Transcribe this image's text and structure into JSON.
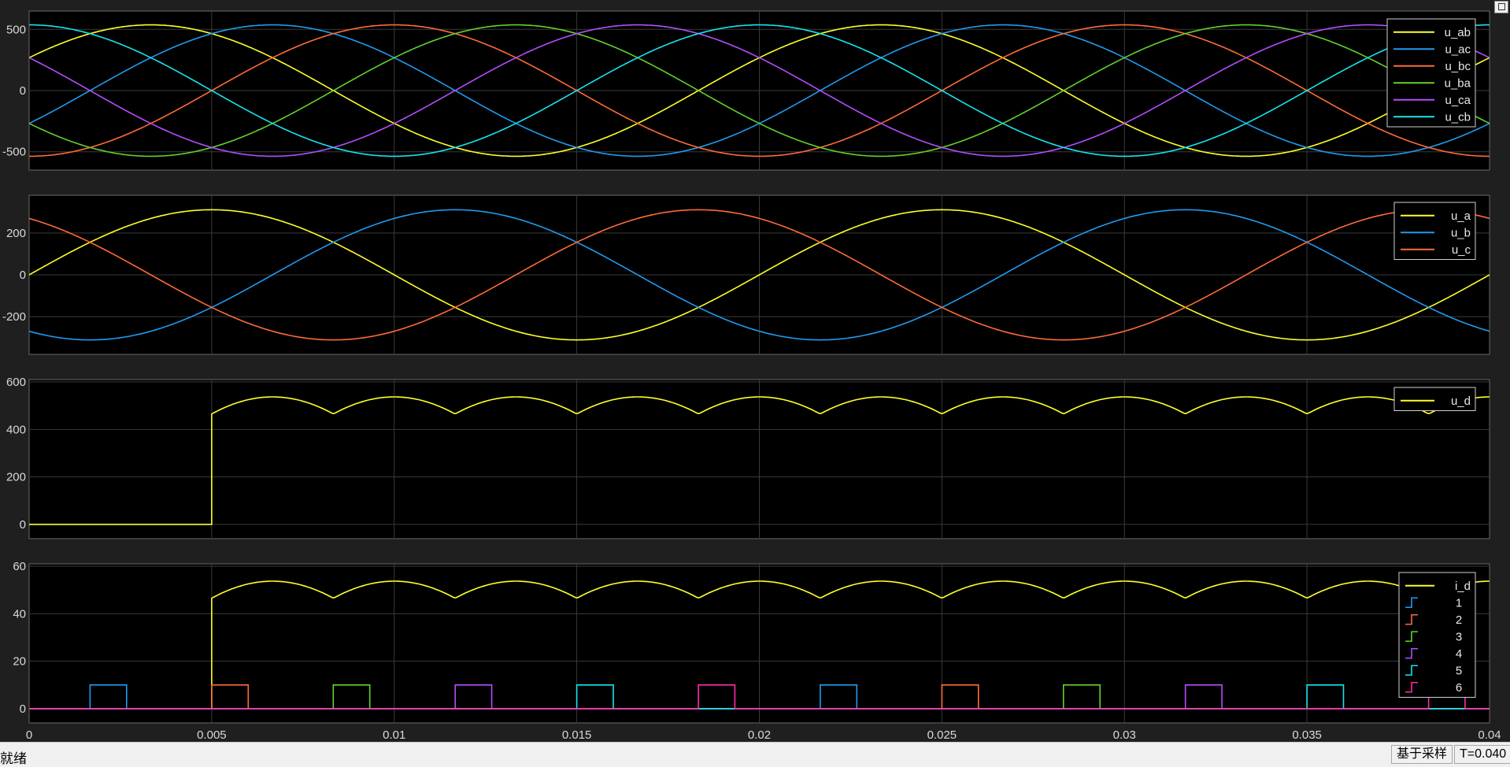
{
  "status": {
    "ready": "就绪",
    "mode": "基于采样",
    "time": "T=0.040"
  },
  "colors": {
    "background": "#000000",
    "grid": "#3a3a3a",
    "axis_text": "#d9d9d9",
    "yellow": "#ffff2a",
    "blue": "#1f9bf0",
    "orange": "#ff6b36",
    "green": "#62d22d",
    "purple": "#b44dff",
    "cyan": "#16e5f0",
    "magenta": "#ff2aa8"
  },
  "chart_data": [
    {
      "type": "line",
      "title": "",
      "xlim": [
        0,
        0.04
      ],
      "ylim": [
        -650,
        650
      ],
      "yticks": [
        -500,
        0,
        500
      ],
      "grid": true,
      "legend": "top-right",
      "series": [
        {
          "name": "u_ab",
          "color": "yellow",
          "amplitude": 537,
          "phase_deg": 30
        },
        {
          "name": "u_ac",
          "color": "blue",
          "amplitude": 537,
          "phase_deg": -30
        },
        {
          "name": "u_bc",
          "color": "orange",
          "amplitude": 537,
          "phase_deg": -90
        },
        {
          "name": "u_ba",
          "color": "green",
          "amplitude": 537,
          "phase_deg": -150
        },
        {
          "name": "u_ca",
          "color": "purple",
          "amplitude": 537,
          "phase_deg": 150
        },
        {
          "name": "u_cb",
          "color": "cyan",
          "amplitude": 537,
          "phase_deg": 90
        }
      ],
      "frequency_hz": 50
    },
    {
      "type": "line",
      "title": "",
      "xlim": [
        0,
        0.04
      ],
      "ylim": [
        -380,
        380
      ],
      "yticks": [
        -200,
        0,
        200
      ],
      "grid": true,
      "legend": "top-right",
      "series": [
        {
          "name": "u_a",
          "color": "yellow",
          "amplitude": 311,
          "phase_deg": 0
        },
        {
          "name": "u_b",
          "color": "blue",
          "amplitude": 311,
          "phase_deg": -120
        },
        {
          "name": "u_c",
          "color": "orange",
          "amplitude": 311,
          "phase_deg": 120
        }
      ],
      "frequency_hz": 50
    },
    {
      "type": "line",
      "title": "",
      "xlim": [
        0,
        0.04
      ],
      "ylim": [
        -60,
        610
      ],
      "yticks": [
        0,
        200,
        400,
        600
      ],
      "grid": true,
      "legend": "top-right",
      "series": [
        {
          "name": "u_d",
          "color": "yellow",
          "start_time": 0.005,
          "peak": 537,
          "pre_value": 0
        }
      ]
    },
    {
      "type": "line",
      "title": "",
      "xlim": [
        0,
        0.04
      ],
      "ylim": [
        -6,
        61
      ],
      "yticks": [
        0,
        20,
        40,
        60
      ],
      "xticks": [
        0,
        0.005,
        0.01,
        0.015,
        0.02,
        0.025,
        0.03,
        0.035,
        0.04
      ],
      "xtick_labels": [
        "0",
        "0.005",
        "0.01",
        "0.015",
        "0.02",
        "0.025",
        "0.03",
        "0.035",
        "0.04"
      ],
      "grid": true,
      "legend": "top-right",
      "series": [
        {
          "name": "i_d",
          "color": "yellow",
          "start_time": 0.005,
          "peak": 53.7,
          "pre_value": 0
        },
        {
          "name": "1",
          "color": "blue",
          "pulse_starts": [
            0.00167,
            0.02167
          ],
          "pulse_width": 0.001,
          "height": 10
        },
        {
          "name": "2",
          "color": "orange",
          "pulse_starts": [
            0.005,
            0.025
          ],
          "pulse_width": 0.001,
          "height": 10
        },
        {
          "name": "3",
          "color": "green",
          "pulse_starts": [
            0.00833,
            0.02833
          ],
          "pulse_width": 0.001,
          "height": 10
        },
        {
          "name": "4",
          "color": "purple",
          "pulse_starts": [
            0.01167,
            0.03167
          ],
          "pulse_width": 0.001,
          "height": 10
        },
        {
          "name": "5",
          "color": "cyan",
          "pulse_starts": [
            0.015,
            0.035
          ],
          "pulse_width": 0.001,
          "height": 10
        },
        {
          "name": "6",
          "color": "magenta",
          "pulse_starts": [
            0.01833,
            0.03833
          ],
          "pulse_width": 0.001,
          "height": 10
        }
      ]
    }
  ]
}
